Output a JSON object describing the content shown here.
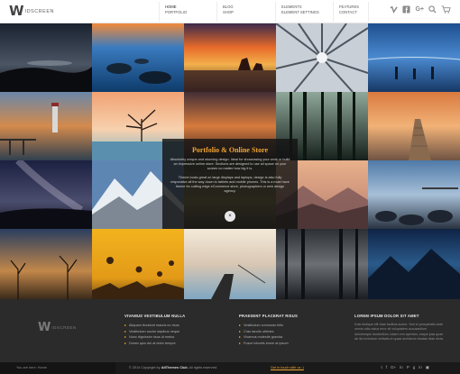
{
  "header": {
    "logo_mark": "W",
    "logo_text": "IDSCREEN",
    "nav": [
      [
        "HOME",
        "PORTFOLIO"
      ],
      [
        "BLOG",
        "SHOP"
      ],
      [
        "ELEMENTS",
        "ELEMENT SETTINGS"
      ],
      [
        "FEATURES",
        "CONTACT"
      ]
    ],
    "icons": [
      "vimeo-icon",
      "facebook-icon",
      "google-plus-icon",
      "search-icon",
      "cart-icon"
    ],
    "google_plus_label": "G+"
  },
  "overlay": {
    "title": "Portfolio & Online Store",
    "paragraph1": "Absolutely unique and stunning design. Ideal for showcasing your work or build an impressive online store. Sections are designed to use all space on your screen no matter how big it is.",
    "paragraph2": "Theme looks great on large displays and laptops, design is also fully responsive all the way down to tablets and mobile phones. This is a must have theme for cutting edge eCommerce store, photographers or web design agency.",
    "close": "×"
  },
  "footer": {
    "logo_mark": "W",
    "logo_text": "IDSCREEN",
    "col1": {
      "title": "VIVAMUS VESTIBULUM NULLA",
      "items": [
        "Aliquam tincidunt mauris eu risus",
        "Vestibulum auctor dapibus neque",
        "Nunc dignissim risus id metus",
        "Donec quis dui at dolor tempor"
      ]
    },
    "col2": {
      "title": "PRAESENT PLACERAT RISUS",
      "items": [
        "Vestibulum commodo felis",
        "Cras iaculis ultricies",
        "Vivamus molestie gravida",
        "Fusce lobortis lorem at ipsum"
      ]
    },
    "col3": {
      "title": "LOREM IPSUM DOLOR SIT AMET",
      "text": "Duis tristique elit vitae facilisis auctor. Sed et perspiciatis wide omnis odio natus error sit voluptatem accusantium doloremque laudantium, totam rem aperiam, eaque ipsa quae ab illo inventore veritatis et quasi architecto beatae vitae dicta."
    },
    "bullet": "▸"
  },
  "bottombar": {
    "you_are_here": "You are here: Home",
    "copyright_pre": "© 2014 Copyright by",
    "copyright_brand": "AitThemes Club",
    "copyright_post": ". All rights reserved.",
    "link": "Get in touch with us :)",
    "social": [
      "t",
      "f",
      "G+",
      "in",
      "P",
      "g",
      "in",
      "▣"
    ]
  },
  "colors": {
    "accent": "#f0a531",
    "header_bg": "#ffffff",
    "footer_bg": "#2b2b2b",
    "bottombar_bg": "#1a1a1a"
  }
}
